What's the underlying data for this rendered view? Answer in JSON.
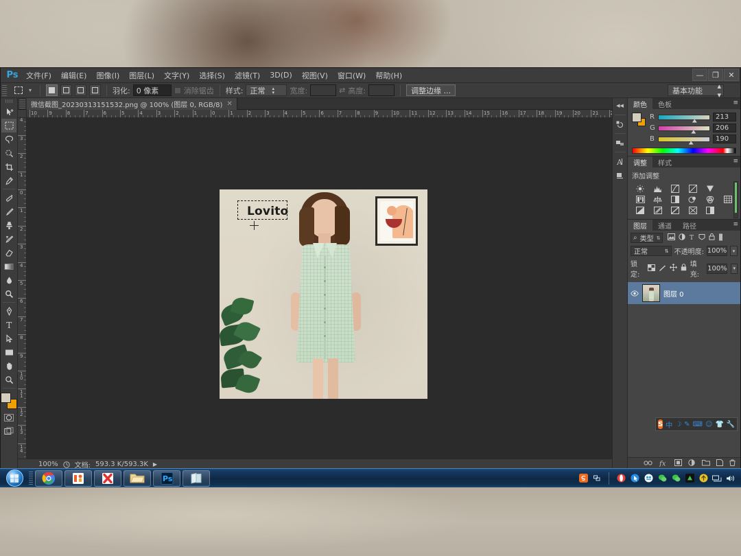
{
  "app": {
    "name": "Adobe Photoshop",
    "logo": "Ps",
    "workspace": "基本功能"
  },
  "window_controls": {
    "minimize": "—",
    "restore": "❐",
    "close": "✕"
  },
  "menu": [
    "文件(F)",
    "编辑(E)",
    "图像(I)",
    "图层(L)",
    "文字(Y)",
    "选择(S)",
    "滤镜(T)",
    "3D(D)",
    "视图(V)",
    "窗口(W)",
    "帮助(H)"
  ],
  "options_bar": {
    "tool": "矩形选框工具",
    "feather_label": "羽化:",
    "feather_value": "0 像素",
    "antialias_label": "消除锯齿",
    "style_label": "样式:",
    "style_value": "正常",
    "width_label": "宽度:",
    "width_value": "",
    "swap_icon": "⇄",
    "height_label": "高度:",
    "height_value": "",
    "refine_edge": "调整边缘 ..."
  },
  "toolbox": {
    "tools": [
      {
        "name": "move-tool",
        "title": "移动工具"
      },
      {
        "name": "rectangular-marquee-tool",
        "title": "矩形选框工具",
        "active": true
      },
      {
        "name": "lasso-tool",
        "title": "套索工具"
      },
      {
        "name": "quick-selection-tool",
        "title": "快速选择工具"
      },
      {
        "name": "crop-tool",
        "title": "裁剪工具"
      },
      {
        "name": "eyedropper-tool",
        "title": "吸管工具"
      },
      {
        "name": "healing-brush-tool",
        "title": "污点修复画笔工具"
      },
      {
        "name": "brush-tool",
        "title": "画笔工具"
      },
      {
        "name": "clone-stamp-tool",
        "title": "仿制图章工具"
      },
      {
        "name": "history-brush-tool",
        "title": "历史记录画笔工具"
      },
      {
        "name": "eraser-tool",
        "title": "橡皮擦工具"
      },
      {
        "name": "gradient-tool",
        "title": "渐变工具"
      },
      {
        "name": "blur-tool",
        "title": "模糊工具"
      },
      {
        "name": "dodge-tool",
        "title": "减淡工具"
      },
      {
        "name": "pen-tool",
        "title": "钢笔工具"
      },
      {
        "name": "type-tool",
        "title": "横排文字工具"
      },
      {
        "name": "path-selection-tool",
        "title": "路径选择工具"
      },
      {
        "name": "rectangle-tool",
        "title": "矩形工具"
      },
      {
        "name": "hand-tool",
        "title": "抓手工具"
      },
      {
        "name": "zoom-tool",
        "title": "缩放工具"
      }
    ],
    "foreground_color": "#d5cebe",
    "background_color": "#f0a000"
  },
  "document": {
    "tab_title": "微信截图_20230313151532.png @ 100% (图层 0, RGB/8)",
    "close_glyph": "✕",
    "zoom": "100%",
    "status_label": "文档:",
    "status_value": "593.3 K/593.3K",
    "play_glyph": "▶",
    "h_ruler_ticks": [
      "10",
      "9",
      "8",
      "7",
      "6",
      "5",
      "4",
      "3",
      "2",
      "1",
      "0",
      "1",
      "2",
      "3",
      "4",
      "5",
      "6",
      "7",
      "8",
      "9",
      "10",
      "11",
      "12",
      "13",
      "14",
      "15",
      "16",
      "17",
      "18",
      "19",
      "20",
      "21",
      "22"
    ],
    "v_ruler_ticks": [
      "4",
      "3",
      "2",
      "1",
      "0",
      "1",
      "2",
      "3",
      "4",
      "5",
      "6",
      "7",
      "8",
      "9",
      "10",
      "11",
      "12",
      "13",
      "14",
      "15"
    ]
  },
  "canvas_image": {
    "logo_text": "Lovito",
    "description": "模特穿薄荷绿格纹连衣裙，墙上挂有抽象装饰画，左下角有龟背竹绿植"
  },
  "panels": {
    "color": {
      "tabs": [
        {
          "label": "颜色",
          "active": true
        },
        {
          "label": "色板",
          "active": false
        }
      ],
      "menu_glyph": "≡",
      "channels": [
        {
          "label": "R",
          "value": "213"
        },
        {
          "label": "G",
          "value": "206"
        },
        {
          "label": "B",
          "value": "190"
        }
      ]
    },
    "adjustments": {
      "tabs": [
        {
          "label": "调整",
          "active": true
        },
        {
          "label": "样式",
          "active": false
        }
      ],
      "menu_glyph": "≡",
      "title": "添加调整",
      "icons": [
        "brightness-contrast-icon",
        "levels-icon",
        "curves-icon",
        "exposure-icon",
        "vibrance-icon",
        "",
        "hue-saturation-icon",
        "color-balance-icon",
        "black-white-icon",
        "photo-filter-icon",
        "channel-mixer-icon",
        "color-lookup-icon",
        "invert-icon",
        "posterize-icon",
        "threshold-icon",
        "gradient-map-icon",
        "selective-color-icon",
        ""
      ]
    },
    "layers": {
      "tabs": [
        {
          "label": "图层",
          "active": true
        },
        {
          "label": "通道",
          "active": false
        },
        {
          "label": "路径",
          "active": false
        }
      ],
      "menu_glyph": "≡",
      "filter_label": "类型",
      "search_glyph": "⌕",
      "blend_mode": "正常",
      "opacity_label": "不透明度:",
      "opacity_value": "100%",
      "lock_label": "锁定:",
      "fill_label": "填充:",
      "fill_value": "100%",
      "items": [
        {
          "name": "图层 0",
          "visible": true,
          "selected": true
        }
      ],
      "footer_icons": [
        "link-layers-icon",
        "layer-style-icon",
        "layer-mask-icon",
        "adjustment-layer-icon",
        "new-group-icon",
        "new-layer-icon",
        "delete-layer-icon"
      ]
    }
  },
  "dock_strip": {
    "collapse_glyph": "◀◀",
    "icons": [
      "history-panel-icon",
      "actions-panel-icon",
      "character-panel-icon",
      "paragraph-panel-icon"
    ]
  },
  "ime_toolbar": {
    "name": "搜狗拼音输入法",
    "logo": "S",
    "items": [
      "中",
      "☽",
      "✎",
      "⌨",
      "☺",
      "👕",
      "🔧"
    ]
  },
  "taskbar": {
    "start_label": "开始",
    "items": [
      {
        "name": "chrome",
        "label": "Google Chrome"
      },
      {
        "name": "wps",
        "label": "WPS"
      },
      {
        "name": "xmind",
        "label": "XMind"
      },
      {
        "name": "explorer",
        "label": "文件资源管理器"
      },
      {
        "name": "photoshop",
        "label": "Adobe Photoshop"
      },
      {
        "name": "notes",
        "label": "便笺"
      }
    ],
    "tray": [
      "sogou-icon",
      "opera-icon",
      "pointer-icon",
      "qq-icon",
      "wechat-icon",
      "wechat2-icon",
      "app-icon",
      "update-icon",
      "network-icon",
      "volume-icon"
    ]
  }
}
